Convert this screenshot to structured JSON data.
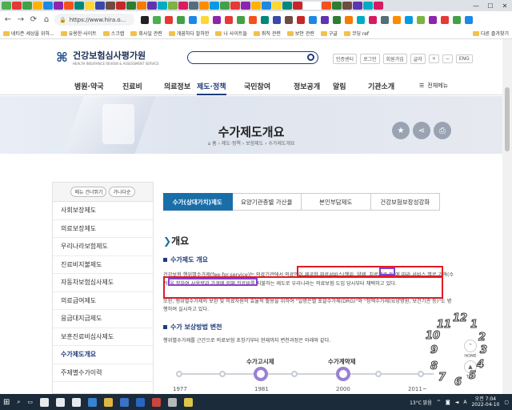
{
  "browser": {
    "url": "https://www.hira.o...",
    "nav": {
      "back": "←",
      "forward": "→",
      "reload": "⟳",
      "home": "⌂"
    },
    "tab_colors": [
      "#4caf50",
      "#e53935",
      "#43a047",
      "#ffb300",
      "#1e88e5",
      "#8e24aa",
      "#f4511e",
      "#00897b",
      "#fdd835",
      "#3949ab",
      "#6d4c41",
      "#c62828",
      "#2e7d32",
      "#f57c00",
      "#5e35b1",
      "#00acc1",
      "#7cb342",
      "#d81b60",
      "#546e7a",
      "#fb8c00",
      "#039be5",
      "#43a047",
      "#e53935",
      "#8e24aa",
      "#ffb300",
      "#1e88e5",
      "#fdd835",
      "#00897b",
      "#c62828",
      "#3949ab",
      "#f4511e",
      "#2e7d32",
      "#6d4c41",
      "#5e35b1",
      "#00acc1",
      "#d81b60"
    ],
    "window_controls": {
      "minimize": "—",
      "maximize": "☐",
      "close": "✕"
    },
    "bookmarks": [
      "네티즌 세상을 위하...",
      "유용한·사이트",
      "스크랩",
      "회사일 관련",
      "개꿈하다 잘하한",
      "나 사이트들",
      "취직 관련",
      "보안 관련",
      "구글",
      "코딩 ref"
    ],
    "bookmark_other": "다른 즐겨찾기"
  },
  "site": {
    "logo_name": "건강보험심사평가원",
    "logo_sub": "HEALTH INSURANCE REVIEW & ASSESSMENT SERVICE",
    "utils": [
      "인증센터",
      "로그인",
      "회원가입",
      "글자",
      "+",
      "−",
      "ENG"
    ],
    "gnb": [
      "병원·약국",
      "진료비",
      "의료정보",
      "제도·정책",
      "국민참여",
      "정보공개",
      "알림",
      "기관소개"
    ],
    "gnb_active_index": 3,
    "all_menu": "전체메뉴"
  },
  "hero": {
    "title": "수가제도개요",
    "breadcrumb": "⌂ 홈 › 제도·정책 › 보험제도 › 수가제도개요"
  },
  "lnb": {
    "top_pills": [
      "메뉴 건너뛰기",
      "가나다순"
    ],
    "items": [
      "사회보장제도",
      "의료보장제도",
      "우리나라보험제도",
      "진료비지불제도",
      "자동차보험심사제도",
      "의료급여제도",
      "응급대지급제도",
      "보훈진료비심사제도",
      "수가제도개요",
      "주제별수가이력"
    ],
    "active_index": 8
  },
  "content_tabs": [
    "수가(상대가치)제도",
    "요양기관종별 가산율",
    "본인부담제도",
    "건강보험보장성강화"
  ],
  "content_tab_active": 0,
  "main": {
    "heading": "개요",
    "section1_title": "수가제도 개요",
    "para1": "건강보험 행위별수가제(fee-for-service)는 의료기관에서 의료인이 제공한 의료서비스(행위, 약제, 치료재료 등)에 따라 서비스 별로 가격(수가)을 정하여 사용량과 가격에 의해 진료비를 지불하는 제도로 우리나라는 의료보험 도입 당시부터 채택하고 있다.",
    "para2": "또한, 행위별수가제의 보완 및 의료자원의 효율적 활용을 위하여 \"일병은별 포괄수가제(DRG)\"와 \"정액수가제(요양병원, 보건기관 등)\"도 병행하여 실시하고 있다.",
    "section2_title": "수가 보상방법 변천",
    "para3": "행위별수가제를 근간으로 의료보험 초창기부터 현재까지 변천과정은 아래와 같다.",
    "timeline_labels": [
      "수가고시제",
      "수가계약제"
    ],
    "timeline_years": [
      "1977",
      "1981",
      "2000",
      "2011~"
    ]
  },
  "side_util": {
    "home": "HOME",
    "top": "TOP"
  },
  "clock_numbers": [
    "12",
    "11",
    "1",
    "10",
    "2",
    "9",
    "3",
    "8",
    "4",
    "7",
    "5",
    "6"
  ],
  "taskbar": {
    "weather": "13°C 맑음",
    "time": "오전 7:04",
    "date": "2022-04-10",
    "lang": "A",
    "icon_colors": [
      "#ffffff",
      "#ffffff",
      "#ffffff",
      "#3c8de0",
      "#f5c542",
      "#3d7bd6",
      "#2b6dd1",
      "#e0483c",
      "#c8c8c8",
      "#f2d64b"
    ]
  },
  "colors": {
    "accent": "#1a6ea8",
    "brand": "#1f3b7a",
    "highlight_red": "#e01c24",
    "highlight_purple": "#8a3fd1"
  }
}
